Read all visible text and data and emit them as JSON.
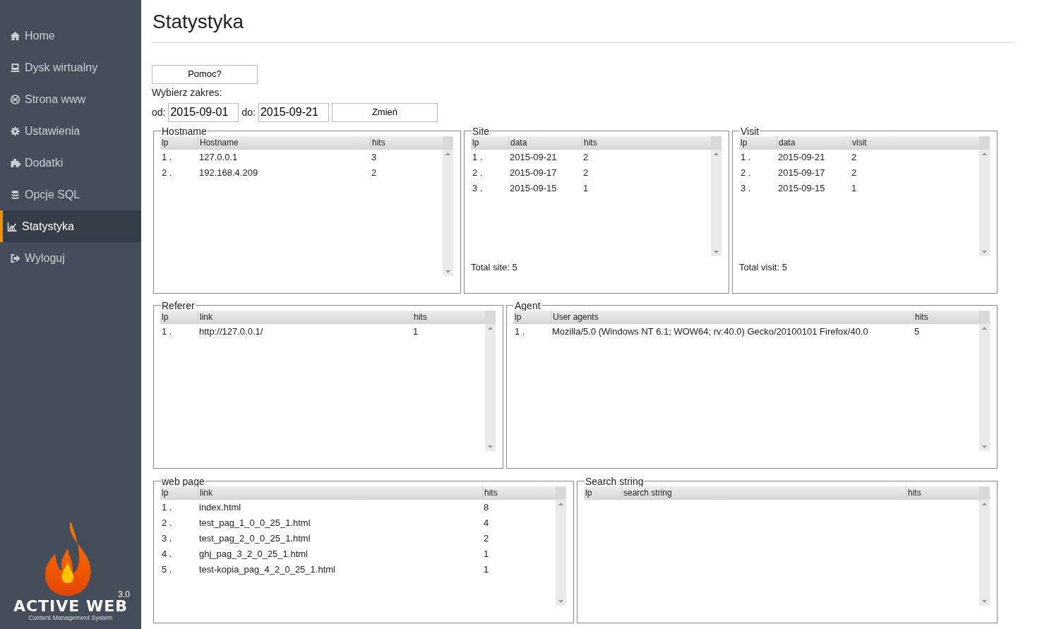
{
  "sidebar": {
    "items": [
      {
        "label": "Home",
        "selected": false
      },
      {
        "label": "Dysk wirtualny",
        "selected": false
      },
      {
        "label": "Strona www",
        "selected": false
      },
      {
        "label": "Ustawienia",
        "selected": false
      },
      {
        "label": "Dodatki",
        "selected": false
      },
      {
        "label": "Opcje SQL",
        "selected": false
      },
      {
        "label": "Statystyka",
        "selected": true
      },
      {
        "label": "Wyloguj",
        "selected": false
      }
    ],
    "logo": {
      "name": "ACTIVE WEB",
      "version": "3.0",
      "tagline": "Content Management System"
    }
  },
  "page_title": "Statystyka",
  "help_button": "Pomoc?",
  "range_label": "Wybierz zakres:",
  "range": {
    "from_label": "od:",
    "from": "2015-09-01",
    "to_label": "do:",
    "to": "2015-09-21",
    "button": "Zmień"
  },
  "panel_rows": [
    [
      {
        "legend": "Hostname",
        "columns": [
          "lp",
          "Hostname",
          "hits"
        ],
        "rows": [
          [
            "1 .",
            "127.0.0.1",
            "3"
          ],
          [
            "2 .",
            "192.168.4.209",
            "2"
          ]
        ]
      },
      {
        "legend": "Site",
        "columns": [
          "lp",
          "data",
          "hits"
        ],
        "rows": [
          [
            "1 .",
            "2015-09-21",
            "2"
          ],
          [
            "2 .",
            "2015-09-17",
            "2"
          ],
          [
            "3 .",
            "2015-09-15",
            "1"
          ]
        ],
        "footer": "Total site: 5"
      },
      {
        "legend": "Visit",
        "columns": [
          "lp",
          "data",
          "visit"
        ],
        "rows": [
          [
            "1 .",
            "2015-09-21",
            "2"
          ],
          [
            "2 .",
            "2015-09-17",
            "2"
          ],
          [
            "3 .",
            "2015-09-15",
            "1"
          ]
        ],
        "footer": "Total visit: 5"
      }
    ],
    [
      {
        "legend": "Referer",
        "columns": [
          "lp",
          "link",
          "hits"
        ],
        "rows": [
          [
            "1 .",
            "http://127.0.0.1/",
            "1"
          ]
        ]
      },
      {
        "legend": "Agent",
        "columns": [
          "lp",
          "User agents",
          "hits"
        ],
        "rows": [
          [
            "1 .",
            "Mozilla/5.0 (Windows NT 6.1; WOW64; rv:40.0) Gecko/20100101 Firefox/40.0",
            "5"
          ]
        ]
      }
    ],
    [
      {
        "legend": "web page",
        "columns": [
          "lp",
          "link",
          "hits"
        ],
        "rows": [
          [
            "1 .",
            "index.html",
            "8"
          ],
          [
            "2 .",
            "test_pag_1_0_0_25_1.html",
            "4"
          ],
          [
            "3 .",
            "test_pag_2_0_0_25_1.html",
            "2"
          ],
          [
            "4 .",
            "ghj_pag_3_2_0_25_1.html",
            "1"
          ],
          [
            "5 .",
            "test-kopia_pag_4_2_0_25_1.html",
            "1"
          ]
        ]
      },
      {
        "legend": "Search string",
        "columns": [
          "lp",
          "search string",
          "hits"
        ]
      }
    ]
  ]
}
